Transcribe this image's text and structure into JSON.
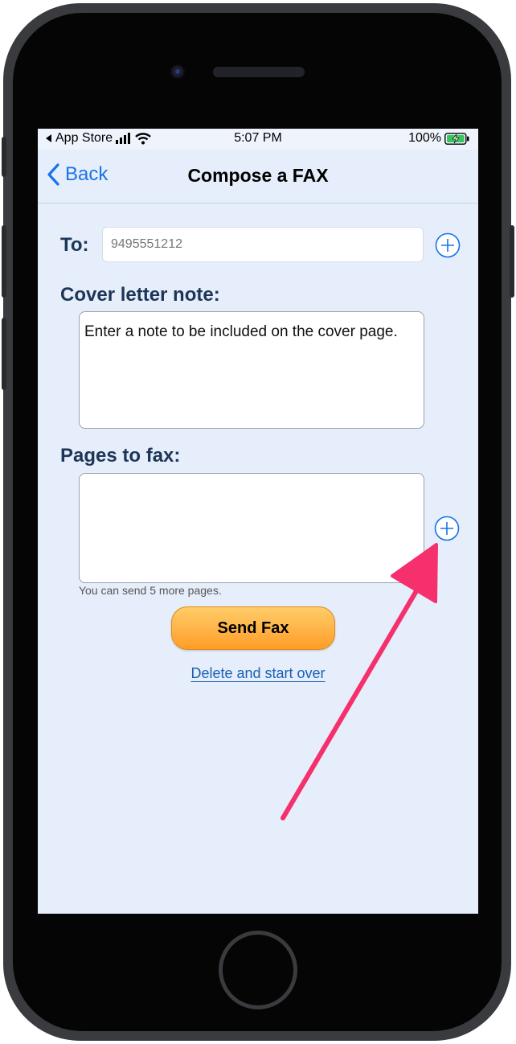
{
  "status_bar": {
    "back_app": "App Store",
    "time": "5:07 PM",
    "battery": "100%"
  },
  "nav": {
    "back_label": "Back",
    "title": "Compose a FAX"
  },
  "form": {
    "to_label": "To:",
    "to_placeholder": "9495551212",
    "cover_label": "Cover letter note:",
    "cover_placeholder": "Enter a note to be included on the cover page.",
    "pages_label": "Pages to fax:",
    "pages_helper": "You can send 5 more pages."
  },
  "actions": {
    "send_label": "Send Fax",
    "delete_label": "Delete and start over"
  },
  "colors": {
    "accent": "#1a73e8",
    "annotation_arrow": "#f5306c",
    "send_button": "#ffad3b"
  }
}
